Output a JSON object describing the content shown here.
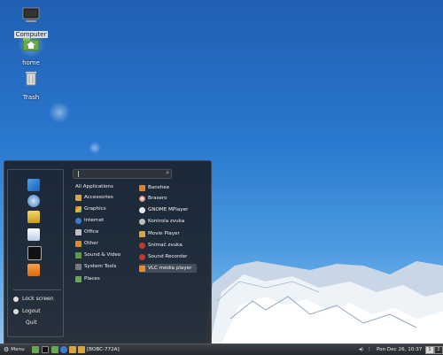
{
  "desktop": {
    "icons": [
      {
        "label": "Computer",
        "icon": "computer-icon",
        "selected": true
      },
      {
        "label": "home",
        "icon": "home-folder-icon",
        "selected": false
      },
      {
        "label": "Trash",
        "icon": "trash-icon",
        "selected": false
      }
    ]
  },
  "menu": {
    "search": {
      "placeholder": ""
    },
    "favorites": [
      {
        "icon": "paint-icon"
      },
      {
        "icon": "network-icon"
      },
      {
        "icon": "archive-icon"
      },
      {
        "icon": "document-icon"
      },
      {
        "icon": "terminal-icon"
      },
      {
        "icon": "vlc-icon"
      }
    ],
    "session": {
      "lock": "Lock screen",
      "logout": "Logout",
      "quit": "Quit"
    },
    "categories": [
      "All Applications",
      "Accessories",
      "Graphics",
      "Internet",
      "Office",
      "Other",
      "Sound & Video",
      "System Tools",
      "Places"
    ],
    "apps": [
      "Banshee",
      "Brasero",
      "GNOME MPlayer",
      "Kontrola zvuka",
      "Movie Player",
      "Snimač zvuka",
      "Sound Recorder",
      "VLC media player"
    ]
  },
  "panel": {
    "menu_label": "Menu",
    "window_title": "[BOBC-772A]",
    "clock": "Pon Dec 26, 10:37",
    "workspaces": [
      "1",
      "2"
    ]
  },
  "colors": {
    "menu_bg": "#1c1f25",
    "panel_bg": "#2e3137",
    "desktop_sky": "#2a78cf"
  }
}
